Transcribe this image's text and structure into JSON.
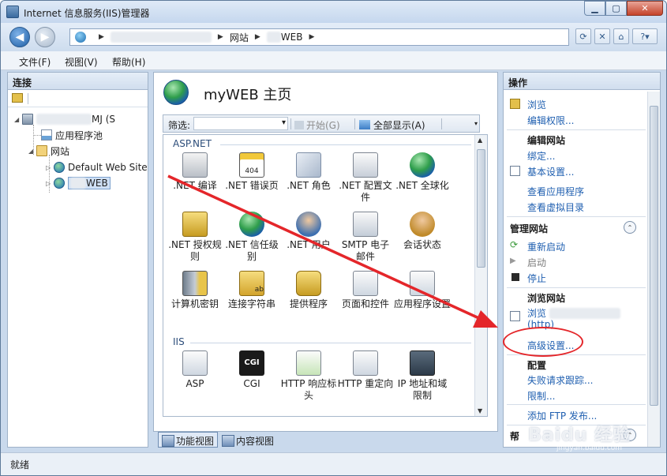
{
  "window": {
    "title": "Internet 信息服务(IIS)管理器",
    "min": "0",
    "max": "1",
    "close": "X"
  },
  "address": {
    "segments": [
      "网站",
      "WEB"
    ]
  },
  "menu": [
    "文件(F)",
    "视图(V)",
    "帮助(H)"
  ],
  "connections": {
    "title": "连接",
    "tree": {
      "server": "MJ (S",
      "app_pools": "应用程序池",
      "sites": "网站",
      "default_site": "Default Web Site",
      "my_site": "WEB"
    }
  },
  "center": {
    "title": "myWEB 主页",
    "filter_label": "筛选:",
    "start_label": "开始(G)",
    "show_all_label": "全部显示(A)",
    "groups": {
      "aspnet": "ASP.NET",
      "iis": "IIS"
    },
    "features": [
      {
        "label": ".NET 编译"
      },
      {
        "label": ".NET 错误页"
      },
      {
        "label": ".NET 角色"
      },
      {
        "label": ".NET 配置文件"
      },
      {
        "label": ".NET 全球化"
      },
      {
        "label": ".NET 授权规则"
      },
      {
        "label": ".NET 信任级别"
      },
      {
        "label": ".NET 用户"
      },
      {
        "label": "SMTP 电子邮件"
      },
      {
        "label": "会话状态"
      },
      {
        "label": "计算机密钥"
      },
      {
        "label": "连接字符串"
      },
      {
        "label": "提供程序"
      },
      {
        "label": "页面和控件"
      },
      {
        "label": "应用程序设置"
      },
      {
        "label": "ASP"
      },
      {
        "label": "CGI"
      },
      {
        "label": "HTTP 响应标头"
      },
      {
        "label": "HTTP 重定向"
      },
      {
        "label": "IP 地址和域限制"
      }
    ],
    "icon_text": {
      "error": "404",
      "cgi": "CGI",
      "conn": "ab"
    },
    "tabs": {
      "features_view": "功能视图",
      "content_view": "内容视图"
    }
  },
  "actions": {
    "title": "操作",
    "browse": "浏览",
    "edit_permissions": "编辑权限...",
    "edit_site": "编辑网站",
    "bindings": "绑定...",
    "basic_settings": "基本设置...",
    "view_apps": "查看应用程序",
    "view_vdirs": "查看虚拟目录",
    "manage_site": "管理网站",
    "restart": "重新启动",
    "start": "启动",
    "stop": "停止",
    "browse_site": "浏览网站",
    "browse_prefix": "浏览",
    "browse_http": "(http)",
    "advanced_settings": "高级设置...",
    "config": "配置",
    "failed_tracing": "失败请求跟踪...",
    "limits": "限制...",
    "add_ftp": "添加 FTP 发布...",
    "help_head": "帮"
  },
  "status": {
    "text": "就绪"
  },
  "watermark": {
    "text": "Baidu 经验",
    "sub": "jingyan.baidu.com"
  },
  "colors": {
    "accent_link": "#1f5fb0",
    "annotation": "#e4262a"
  }
}
